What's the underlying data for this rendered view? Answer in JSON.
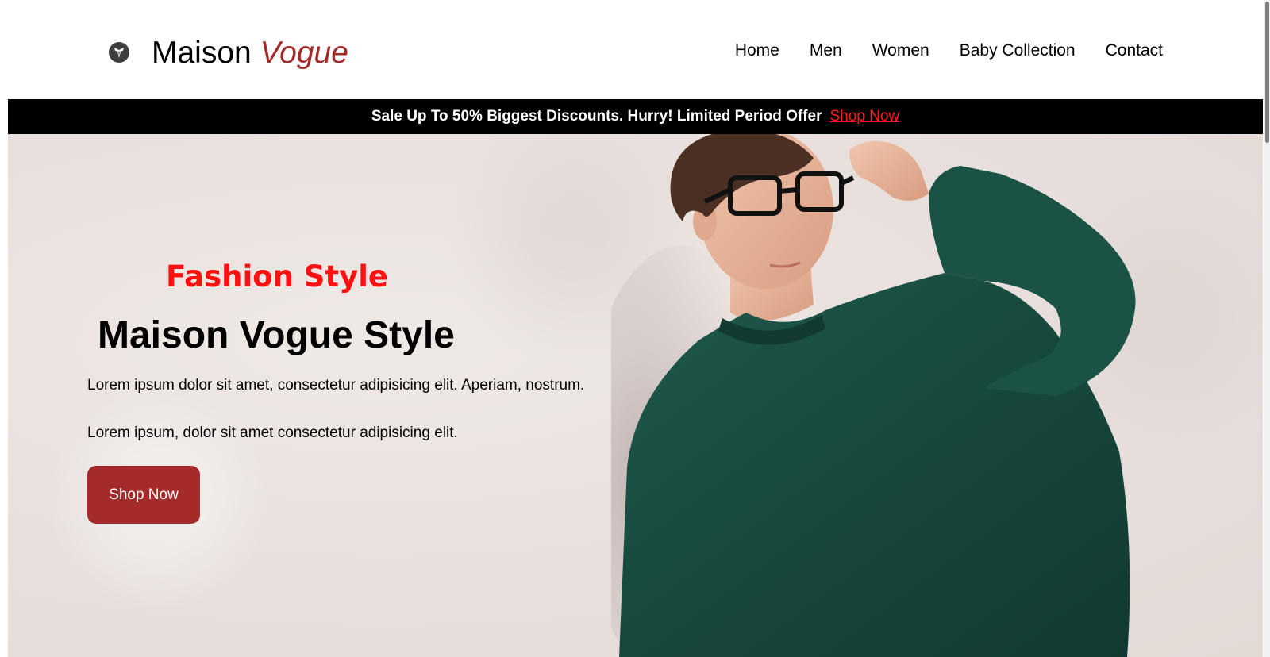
{
  "brand": {
    "name_main": "Maison",
    "name_accent": "Vogue",
    "icon": "bow-tie-logo-icon",
    "accent_color": "#a52a2a"
  },
  "nav": {
    "items": [
      {
        "label": "Home"
      },
      {
        "label": "Men"
      },
      {
        "label": "Women"
      },
      {
        "label": "Baby Collection"
      },
      {
        "label": "Contact"
      }
    ]
  },
  "promo": {
    "text": "Sale Up To 50% Biggest Discounts. Hurry! Limited Period Offer",
    "link_label": "Shop Now",
    "background": "#000000",
    "link_color": "#ff1a1a"
  },
  "hero": {
    "kicker": "Fashion Style",
    "title": "Maison Vogue Style",
    "paragraph_1": "Lorem ipsum dolor sit amet, consectetur adipisicing elit. Aperiam, nostrum.",
    "paragraph_2": "Lorem ipsum, dolor sit amet consectetur adipisicing elit.",
    "button_label": "Shop Now",
    "kicker_color": "#ff1111",
    "button_color": "#a52a2a",
    "image": "man-in-green-sweater-with-glasses"
  }
}
